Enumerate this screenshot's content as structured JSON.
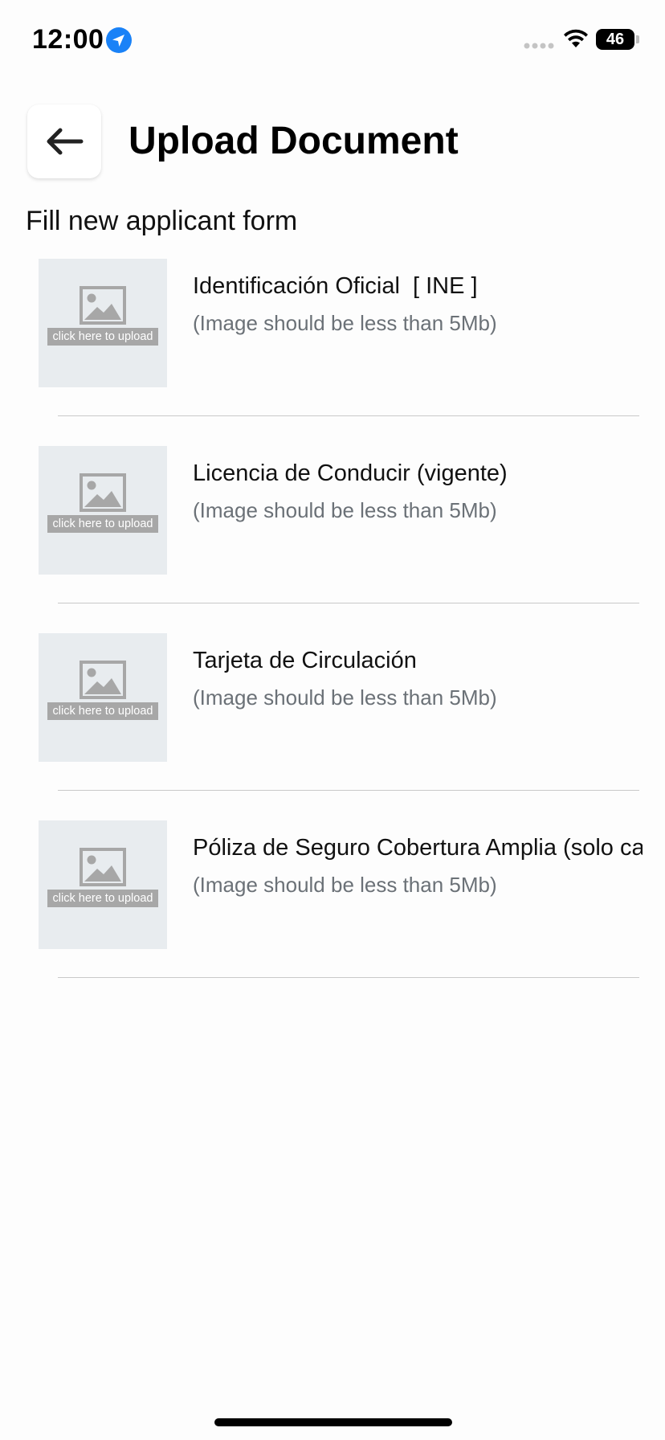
{
  "status_bar": {
    "time": "12:00",
    "battery": "46"
  },
  "header": {
    "title": "Upload Document"
  },
  "subtitle": "Fill new applicant form",
  "documents": [
    {
      "title": "Identificación Oficial  [ INE ]",
      "note": "(Image should be less than 5Mb)",
      "upload_label": "click here to upload"
    },
    {
      "title": "Licencia de Conducir (vigente)",
      "note": "(Image should be less than 5Mb)",
      "upload_label": "click here to upload"
    },
    {
      "title": "Tarjeta de Circulación",
      "note": "(Image should be less than 5Mb)",
      "upload_label": "click here to upload"
    },
    {
      "title": "Póliza de Seguro Cobertura Amplia (solo ca",
      "note": "(Image should be less than 5Mb)",
      "upload_label": "click here to upload"
    }
  ],
  "colors": {
    "location_blue": "#1a82f7",
    "upload_box_bg": "#e8ecef",
    "note_gray": "#6b7177"
  }
}
